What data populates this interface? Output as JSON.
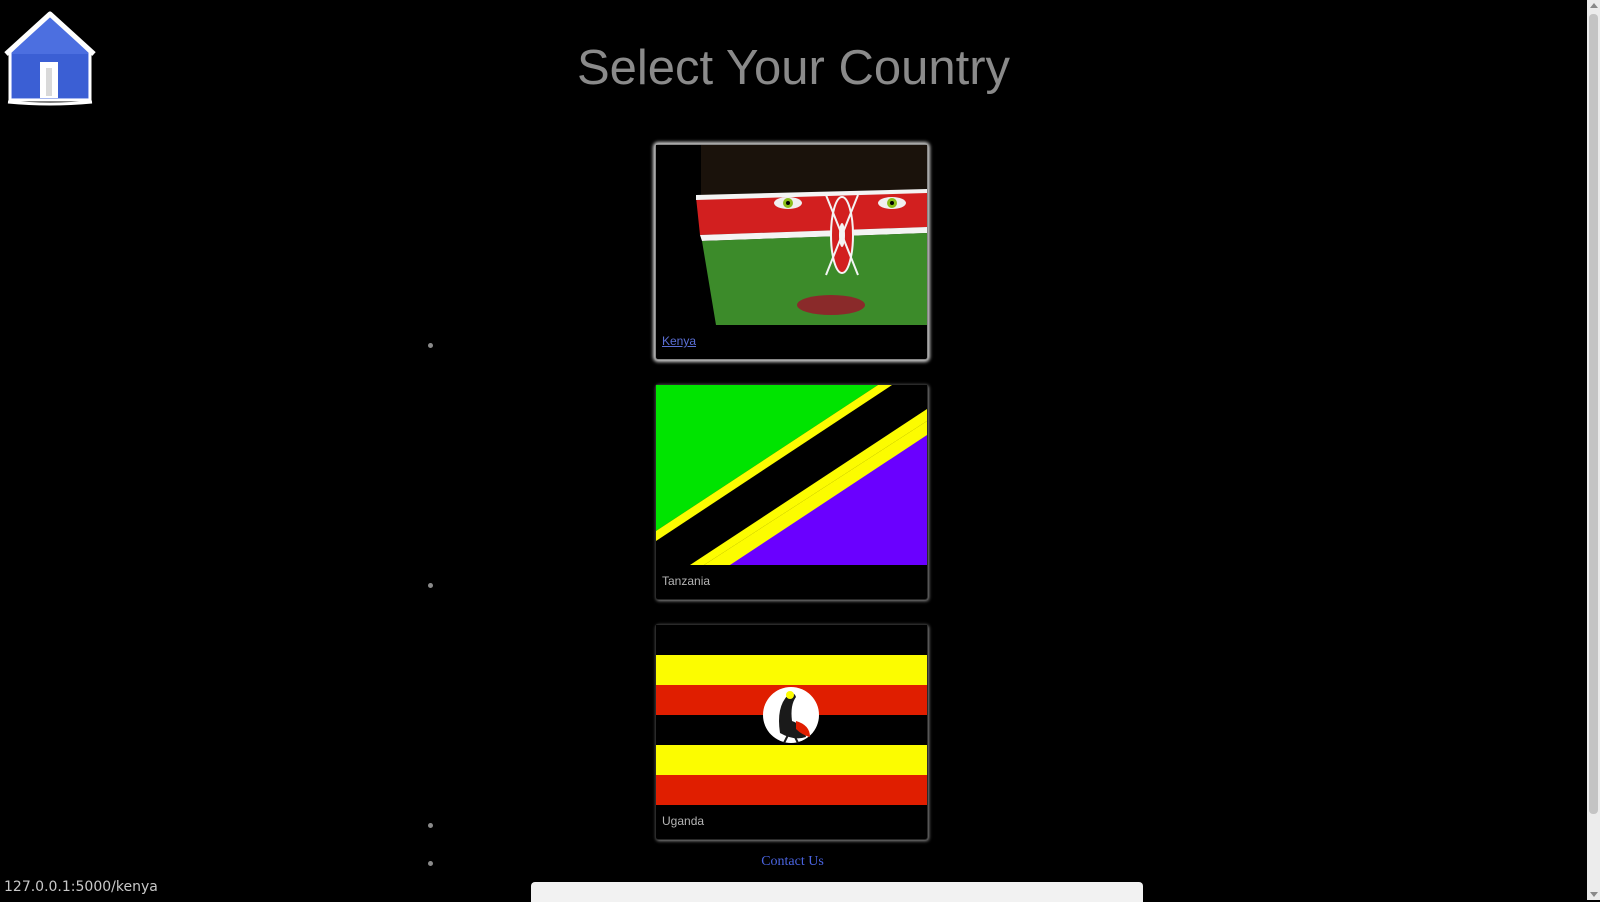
{
  "header": {
    "title": "Select Your Country",
    "home_icon": "house-icon"
  },
  "countries": [
    {
      "label": "Kenya",
      "image": "kenya-flag-face",
      "active": true
    },
    {
      "label": "Tanzania",
      "image": "tanzania-flag",
      "active": false
    },
    {
      "label": "Uganda",
      "image": "uganda-flag",
      "active": false
    }
  ],
  "footer": {
    "contact_label": "Contact Us"
  },
  "status_bar": {
    "url": "127.0.0.1:5000/kenya"
  },
  "colors": {
    "background": "#000000",
    "title": "#8a8a8a",
    "link": "#4a64e0",
    "kenya_red": "#d21f1f",
    "kenya_green": "#3c8b2a",
    "tanzania_green": "#00e400",
    "tanzania_yellow": "#fcfc00",
    "tanzania_blue": "#6a00ff",
    "uganda_yellow": "#fcfc00",
    "uganda_red": "#e01e00"
  }
}
